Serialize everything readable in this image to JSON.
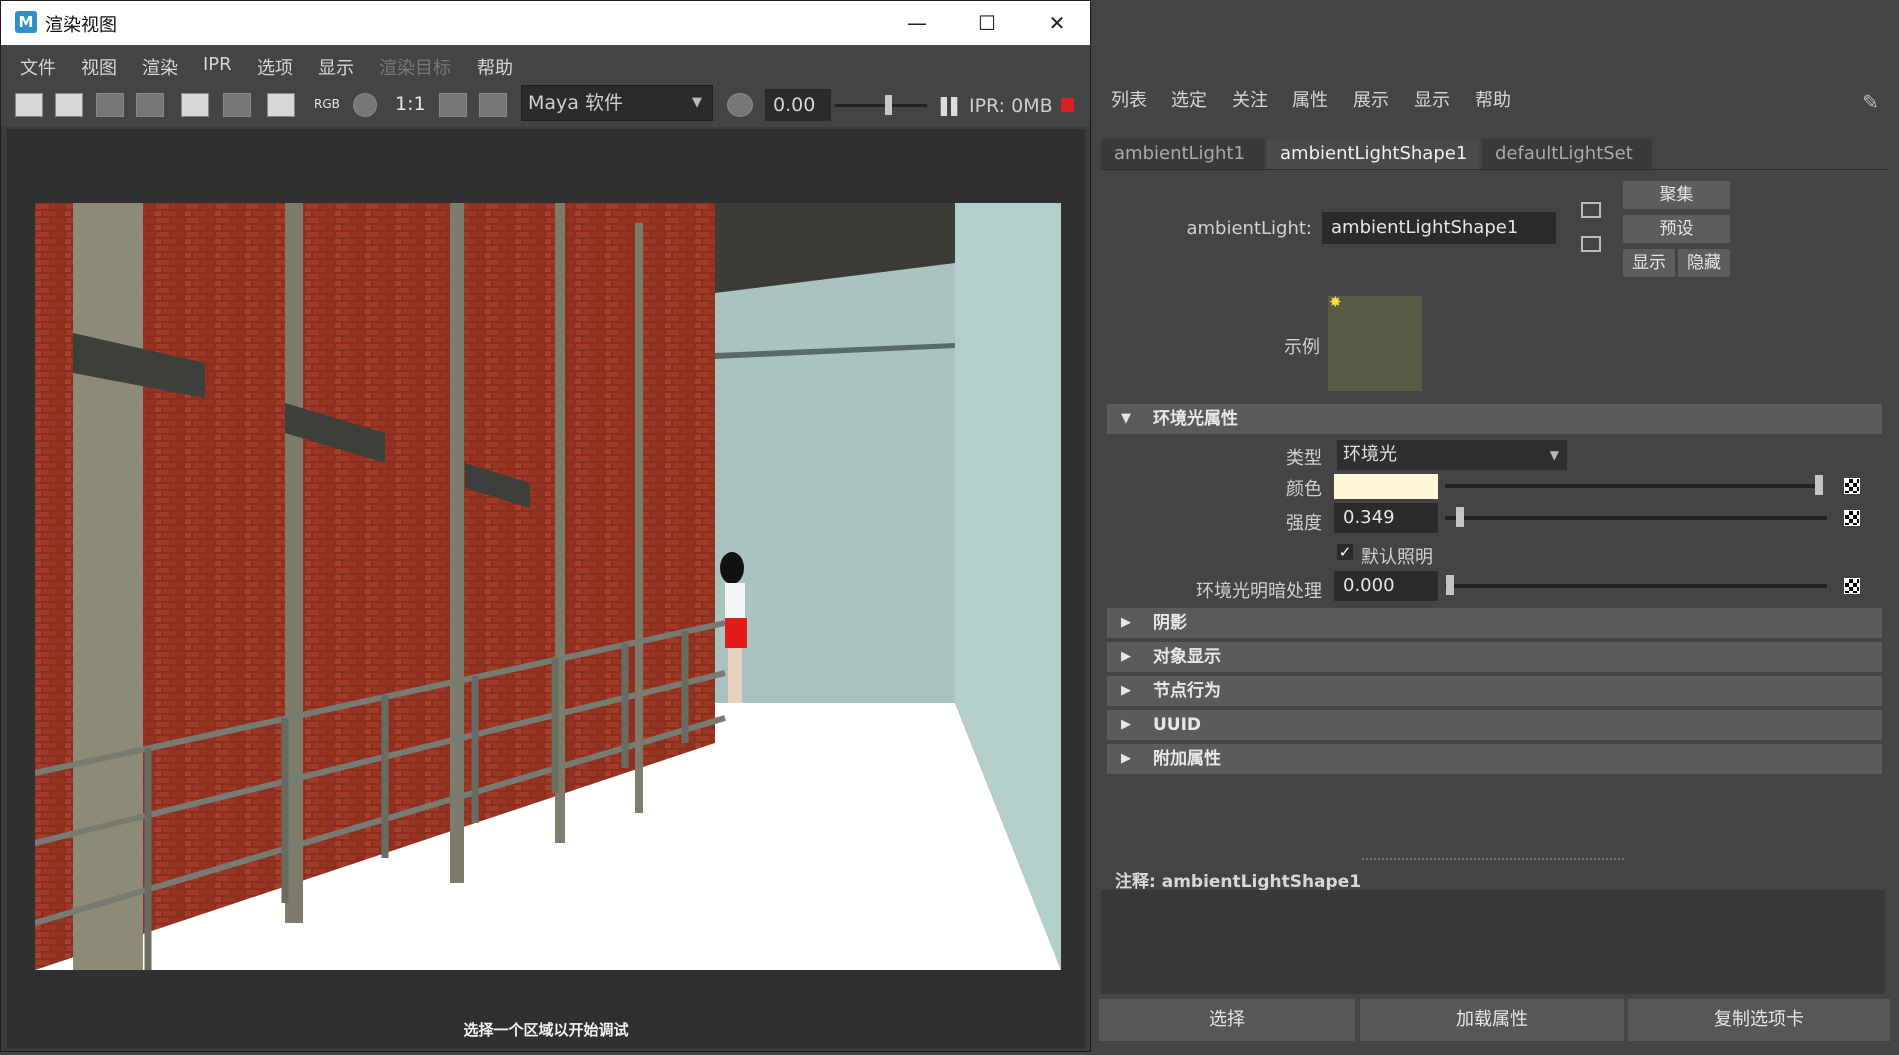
{
  "render_view": {
    "title": "渲染视图",
    "app_icon": "M",
    "window_controls": {
      "minimize": "—",
      "maximize": "☐",
      "close": "✕"
    },
    "menu": [
      "文件",
      "视图",
      "渲染",
      "IPR",
      "选项",
      "显示",
      "渲染目标",
      "帮助"
    ],
    "toolbar": {
      "rgb_label": "RGB",
      "ratio_label": "1:1",
      "renderer": "Maya 软件",
      "exposure": "0.00",
      "ipr_memory": "IPR: 0MB"
    },
    "status": "选择一个区域以开始调试"
  },
  "attribute_editor": {
    "menu": [
      "列表",
      "选定",
      "关注",
      "属性",
      "展示",
      "显示",
      "帮助"
    ],
    "tabs": [
      "ambientLight1",
      "ambientLightShape1",
      "defaultLightSet"
    ],
    "active_tab": 1,
    "node_type_label": "ambientLight:",
    "node_name": "ambientLightShape1",
    "buttons": {
      "focus": "聚集",
      "presets": "预设",
      "show": "显示",
      "hide": "隐藏"
    },
    "sample_label": "示例",
    "sections": {
      "ambient": "环境光属性",
      "shadows": "阴影",
      "object_display": "对象显示",
      "node_behavior": "节点行为",
      "uuid": "UUID",
      "extra": "附加属性"
    },
    "type_label": "类型",
    "type_value": "环境光",
    "color_label": "颜色",
    "color_value": "#fff6d6",
    "intensity_label": "强度",
    "intensity_value": "0.349",
    "default_lighting_label": "默认照明",
    "default_lighting_checked": true,
    "ambient_shade_label": "环境光明暗处理",
    "ambient_shade_value": "0.000",
    "notes_label": "注释: ambientLightShape1",
    "bottom_buttons": [
      "选择",
      "加载属性",
      "复制选项卡"
    ]
  }
}
